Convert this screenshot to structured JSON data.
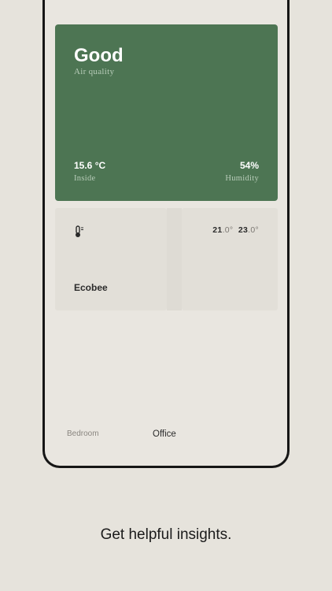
{
  "air_quality": {
    "status": "Good",
    "subtitle": "Air quality",
    "inside_value": "15.6 °C",
    "inside_label": "Inside",
    "humidity_value": "54%",
    "humidity_label": "Humidity"
  },
  "devices": {
    "ecobee": {
      "name": "Ecobee",
      "icon": "thermometer-icon"
    },
    "temps": {
      "low_whole": "21",
      "low_frac": ".0°",
      "high_whole": "23",
      "high_frac": ".0°"
    }
  },
  "tabs": [
    {
      "label": "Bedroom",
      "active": false
    },
    {
      "label": "Office",
      "active": true
    }
  ],
  "caption": "Get helpful insights.",
  "colors": {
    "card_green": "#4d7553",
    "background": "#e6e3dc",
    "frame": "#161616"
  }
}
